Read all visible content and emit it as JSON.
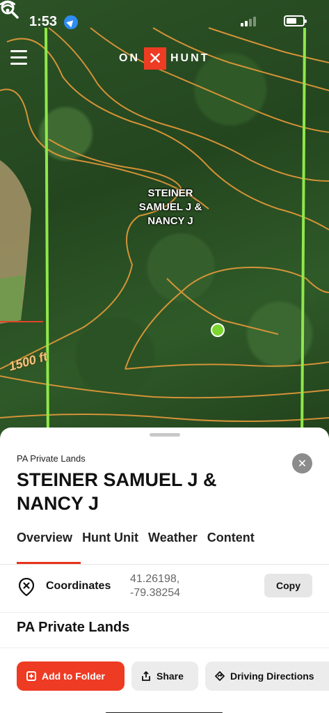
{
  "status_bar": {
    "time": "1:53",
    "location_icon": "location-arrow-icon",
    "signal_icon": "cellular-signal-icon",
    "wifi_icon": "wifi-icon",
    "battery_icon": "battery-icon"
  },
  "header": {
    "menu_icon": "hamburger-menu-icon",
    "logo_left": "ON",
    "logo_mark": "✕",
    "logo_right": "HUNT",
    "search_icon": "search-icon",
    "brand_color": "#ee3b23"
  },
  "map": {
    "parcel_label": "STEINER SAMUEL J & NANCY J",
    "contour_label": "1500 ft",
    "boundary_color": "#8ee84a",
    "contour_color": "#e69a3a",
    "marker_color": "#7bd62e"
  },
  "sheet": {
    "subtitle": "PA Private Lands",
    "title": "STEINER SAMUEL J & NANCY J",
    "close_icon": "close-icon",
    "tabs": [
      {
        "label": "Overview",
        "active": true
      },
      {
        "label": "Hunt Unit",
        "active": false
      },
      {
        "label": "Weather",
        "active": false
      },
      {
        "label": "Content",
        "active": false
      }
    ],
    "coordinates": {
      "icon": "map-pin-x-icon",
      "label": "Coordinates",
      "lat": "41.26198,",
      "lng": "-79.38254",
      "copy_label": "Copy"
    },
    "section_title": "PA Private Lands"
  },
  "actions": {
    "add_label": "Add to Folder",
    "add_icon": "add-folder-icon",
    "share_label": "Share",
    "share_icon": "share-icon",
    "directions_label": "Driving Directions",
    "directions_icon": "directions-icon"
  }
}
